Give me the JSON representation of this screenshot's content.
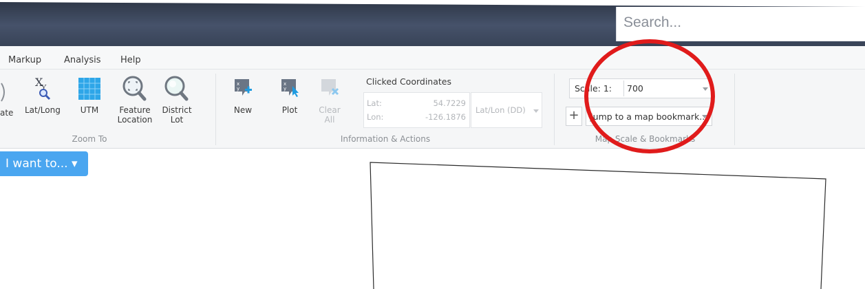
{
  "header": {
    "search_placeholder": "Search..."
  },
  "menu": {
    "items": [
      "Markup",
      "Analysis",
      "Help"
    ]
  },
  "ribbon": {
    "partial_label": "ate",
    "zoom_to": {
      "tools": [
        {
          "label_line1": "Lat/Long",
          "label_line2": "",
          "icon": "lat-long-icon"
        },
        {
          "label_line1": "UTM",
          "label_line2": "",
          "icon": "utm-grid-icon"
        },
        {
          "label_line1": "Feature",
          "label_line2": "Location",
          "icon": "feature-location-icon"
        },
        {
          "label_line1": "District",
          "label_line2": "Lot",
          "icon": "district-lot-icon"
        }
      ],
      "group_label": "Zoom To"
    },
    "information_actions": {
      "tools": [
        {
          "label": "New",
          "icon": "new-coordinate-icon"
        },
        {
          "label": "Plot",
          "icon": "plot-coordinate-icon"
        },
        {
          "label": "Clear All",
          "icon": "clear-all-icon"
        }
      ],
      "clicked_coordinates_title": "Clicked Coordinates",
      "lat_label": "Lat:",
      "lon_label": "Lon:",
      "lat_value": "54.7229",
      "lon_value": "-126.1876",
      "format_value": "Lat/Lon (DD)",
      "group_label": "Information & Actions"
    },
    "map_scale": {
      "scale_label": "Scale: 1:",
      "scale_value": "700",
      "bookmark_value": "Jump to a map bookmark...",
      "add_label": "+",
      "group_label": "Map Scale & Bookmarks"
    }
  },
  "i_want_to": {
    "label": "I want to... ▾"
  },
  "colors": {
    "banner_dark": "#2d3646",
    "accent_blue": "#4aa6f0",
    "annotation_red": "#e01b1b"
  }
}
